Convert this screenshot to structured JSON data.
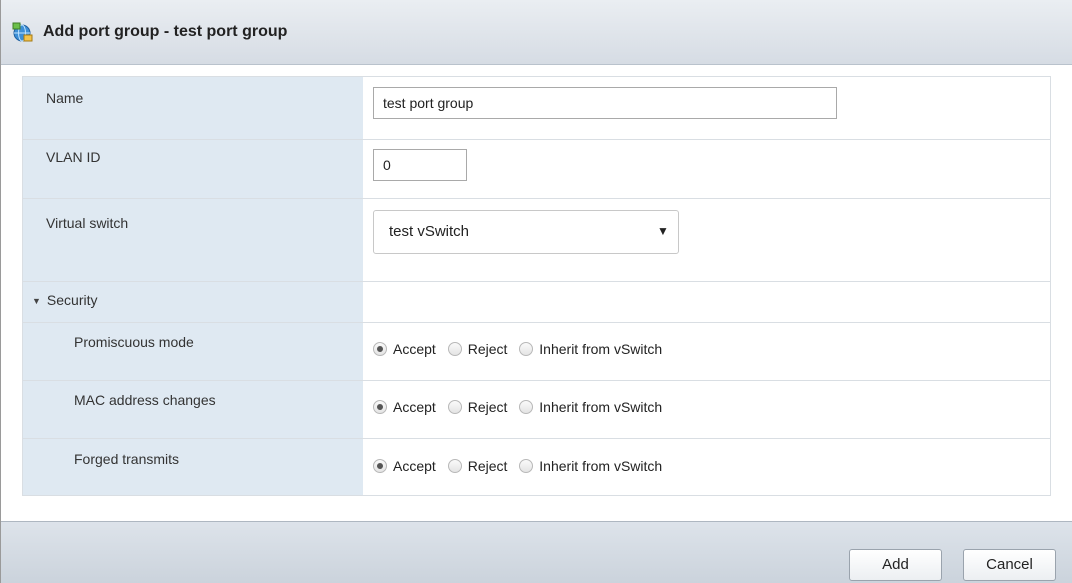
{
  "dialog": {
    "title": "Add port group - test port group",
    "icon": "network-portgroup-icon"
  },
  "form": {
    "name": {
      "label": "Name",
      "value": "test port group"
    },
    "vlan": {
      "label": "VLAN ID",
      "value": "0"
    },
    "vswitch": {
      "label": "Virtual switch",
      "selected": "test vSwitch"
    },
    "security": {
      "label": "Security",
      "expanded": true,
      "options": [
        "Accept",
        "Reject",
        "Inherit from vSwitch"
      ],
      "rows": [
        {
          "label": "Promiscuous mode",
          "selected": "Accept"
        },
        {
          "label": "MAC address changes",
          "selected": "Accept"
        },
        {
          "label": "Forged transmits",
          "selected": "Accept"
        }
      ]
    }
  },
  "buttons": {
    "add": "Add",
    "cancel": "Cancel"
  },
  "colors": {
    "label_background": "#dfe9f2",
    "titlebar": "#dce2e9",
    "footer": "#d3dae2"
  }
}
